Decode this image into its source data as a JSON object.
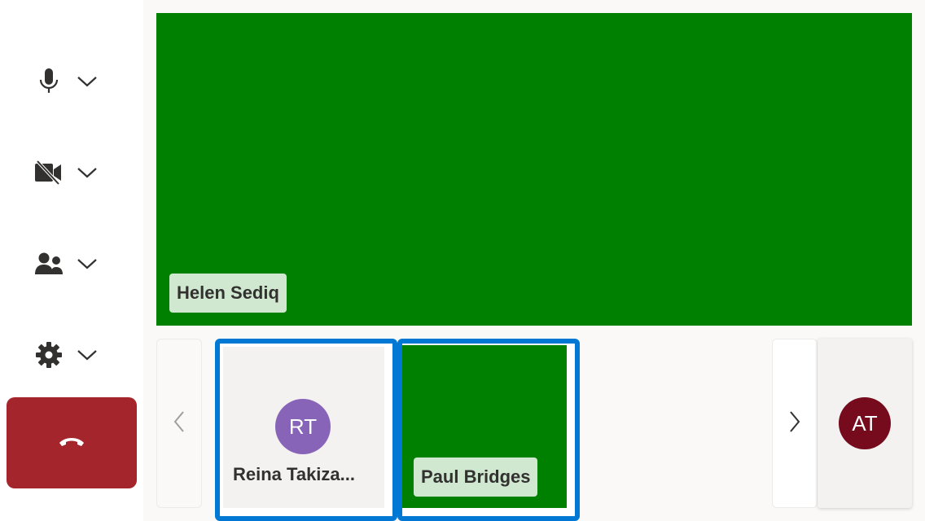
{
  "controls": {
    "mic": {
      "icon": "microphone-icon",
      "options_icon": "chevron-down-icon"
    },
    "camera": {
      "icon": "camera-off-icon",
      "options_icon": "chevron-down-icon"
    },
    "people": {
      "icon": "people-icon",
      "options_icon": "chevron-down-icon"
    },
    "settings": {
      "icon": "gear-icon",
      "options_icon": "chevron-down-icon"
    },
    "hangup": {
      "icon": "phone-hangup-icon",
      "color": "#a4262c"
    }
  },
  "main_video": {
    "participant_name": "Helen Sediq",
    "background_color": "#008000"
  },
  "gallery": {
    "prev_icon": "chevron-left-icon",
    "next_icon": "chevron-right-icon",
    "tiles": [
      {
        "name": "Reina Takiza...",
        "initials": "RT",
        "avatar_color": "#8764b8",
        "video": false
      },
      {
        "name": "Paul Bridges",
        "video": true,
        "background_color": "#008000"
      }
    ],
    "highlight_color": "#0078d4"
  },
  "self_view": {
    "initials": "AT",
    "avatar_color": "#750b1c"
  }
}
